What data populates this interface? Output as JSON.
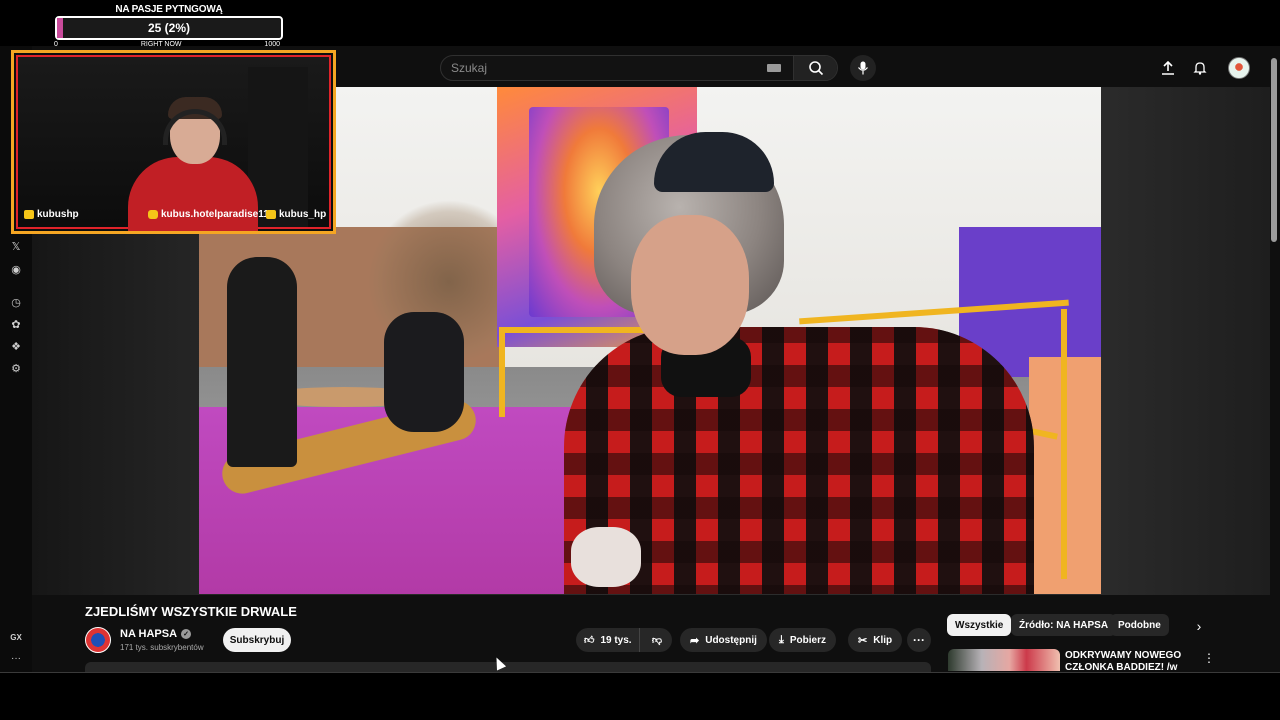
{
  "stream_overlay": {
    "goal_title": "NA PASJE PYTNGOWĄ",
    "goal_value_text": "25 (2%)",
    "goal_progress": 0.025,
    "goal_min": "0",
    "goal_mid_label": "RIGHT NOW",
    "goal_max": "1000",
    "accent_color": "#f5a623",
    "border_color": "#e0232a",
    "socials": [
      {
        "icon": "twitter-icon",
        "label": "kubushp"
      },
      {
        "icon": "instagram-icon",
        "label": "kubus.hotelparadise11"
      },
      {
        "icon": "youtube-icon",
        "label": "kubus_hp"
      }
    ]
  },
  "search": {
    "placeholder": "Szukaj"
  },
  "video": {
    "title": "ZJEDLIŚMY WSZYSTKIE DRWALE",
    "channel_name": "NA HAPSA",
    "channel_subs": "171 tys. subskrybentów",
    "subscribe_label": "Subskrybuj",
    "likes": "19 tys.",
    "share_label": "Udostępnij",
    "download_label": "Pobierz",
    "clip_label": "Klip"
  },
  "chips": [
    "Wszystkie",
    "Źródło: NA HAPSA",
    "Podobne"
  ],
  "recommendation": {
    "title": "ODKRYWAMY NOWEGO CZŁONKA BADDIEZ! /w"
  },
  "left_rail_bottom": {
    "label": "GX",
    "more": "···"
  },
  "colors": {
    "background": "#0f0f0f",
    "pill": "#272727",
    "subscribe_bg": "#f1f1f1"
  }
}
